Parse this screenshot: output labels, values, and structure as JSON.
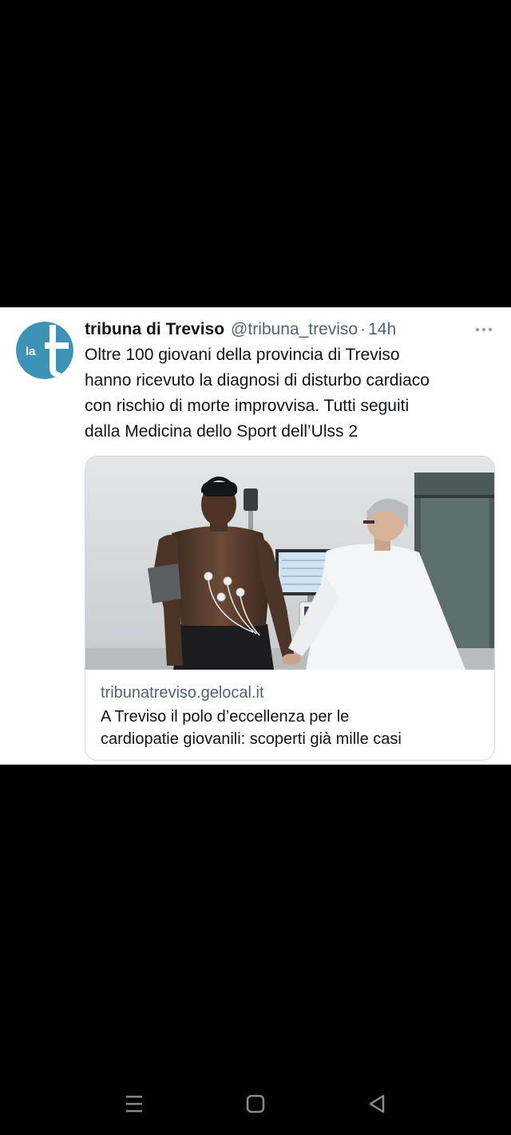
{
  "tweet": {
    "avatar_icon": "tribuna-logo-icon",
    "avatar_text": "la",
    "display_name": "tribuna di Treviso",
    "handle": "@tribuna_treviso",
    "separator": "·",
    "time": "14h",
    "more_icon": "more-horizontal-icon",
    "text": "Oltre 100 giovani della provincia di Treviso\nhanno ricevuto la diagnosi di disturbo cardiaco\ncon rischio di morte improvvisa. Tutti seguiti\ndalla Medicina dello Sport dell’Ulss 2",
    "card": {
      "image_icon": "article-photo",
      "domain": "tribunatreviso.gelocal.it",
      "title": "A Treviso il polo d’eccellenza per le\ncardiopatie giovanili: scoperti già mille casi"
    }
  },
  "navbar": {
    "menu_icon": "recent-apps-icon",
    "home_icon": "home-square-icon",
    "back_icon": "back-triangle-icon"
  },
  "colors": {
    "background": "#000000",
    "card_bg": "#ffffff",
    "text": "#0f1419",
    "secondary_text": "#536471",
    "border": "#cfd9de",
    "avatar_bg": "#3d93b5",
    "navbar_icon": "#8a8a8a"
  }
}
